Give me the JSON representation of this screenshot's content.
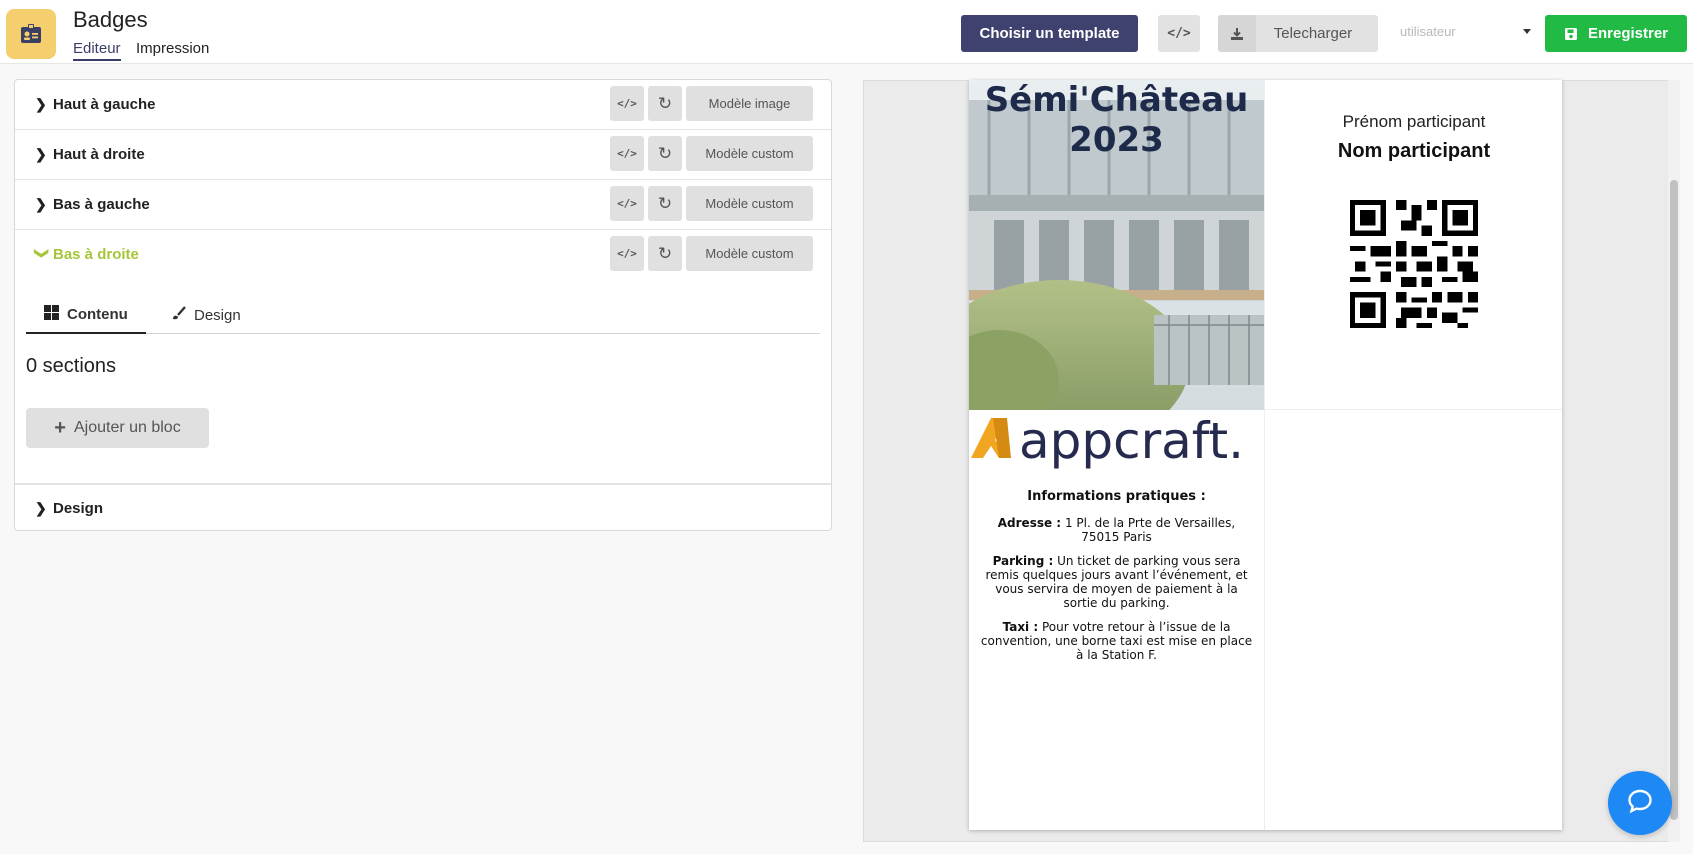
{
  "header": {
    "app_icon": "id-badge-icon",
    "title": "Badges",
    "tabs": [
      {
        "label": "Editeur",
        "active": true
      },
      {
        "label": "Impression",
        "active": false
      }
    ],
    "choose_template_label": "Choisir un template",
    "code_icon": "code-icon",
    "download_label": "Telecharger",
    "user_select_placeholder": "utilisateur",
    "save_label": "Enregistrer",
    "colors": {
      "primary": "#3f416e",
      "save": "#21ba45",
      "accent": "#a5c63a"
    }
  },
  "editor": {
    "sections": [
      {
        "title": "Haut à gauche",
        "model_label": "Modèle image",
        "open": false
      },
      {
        "title": "Haut à droite",
        "model_label": "Modèle custom",
        "open": false
      },
      {
        "title": "Bas à gauche",
        "model_label": "Modèle custom",
        "open": false
      },
      {
        "title": "Bas à droite",
        "model_label": "Modèle custom",
        "open": true
      }
    ],
    "sub_tabs": [
      {
        "label": "Contenu",
        "icon": "grid-icon",
        "active": true
      },
      {
        "label": "Design",
        "icon": "paint-brush-icon",
        "active": false
      }
    ],
    "sections_count": "0 sections",
    "add_block_label": "Ajouter un bloc",
    "design_section_title": "Design"
  },
  "badge": {
    "event_title": "Sémi'Château 2023",
    "first_name": "Prénom participant",
    "last_name": "Nom participant",
    "logo_text": "appcraft.",
    "info_title": "Informations pratiques :",
    "info": [
      {
        "label": "Adresse :",
        "text": "1 Pl. de la Prte de Versailles, 75015 Paris"
      },
      {
        "label": "Parking :",
        "text": "Un ticket de parking vous sera remis quelques jours avant l’événement, et vous servira de moyen de paiement à la sortie du parking."
      },
      {
        "label": "Taxi :",
        "text": "Pour votre retour à l’issue de la convention, une borne taxi est mise en place à la Station F."
      }
    ]
  },
  "chat_icon": "chat-bubble-icon"
}
